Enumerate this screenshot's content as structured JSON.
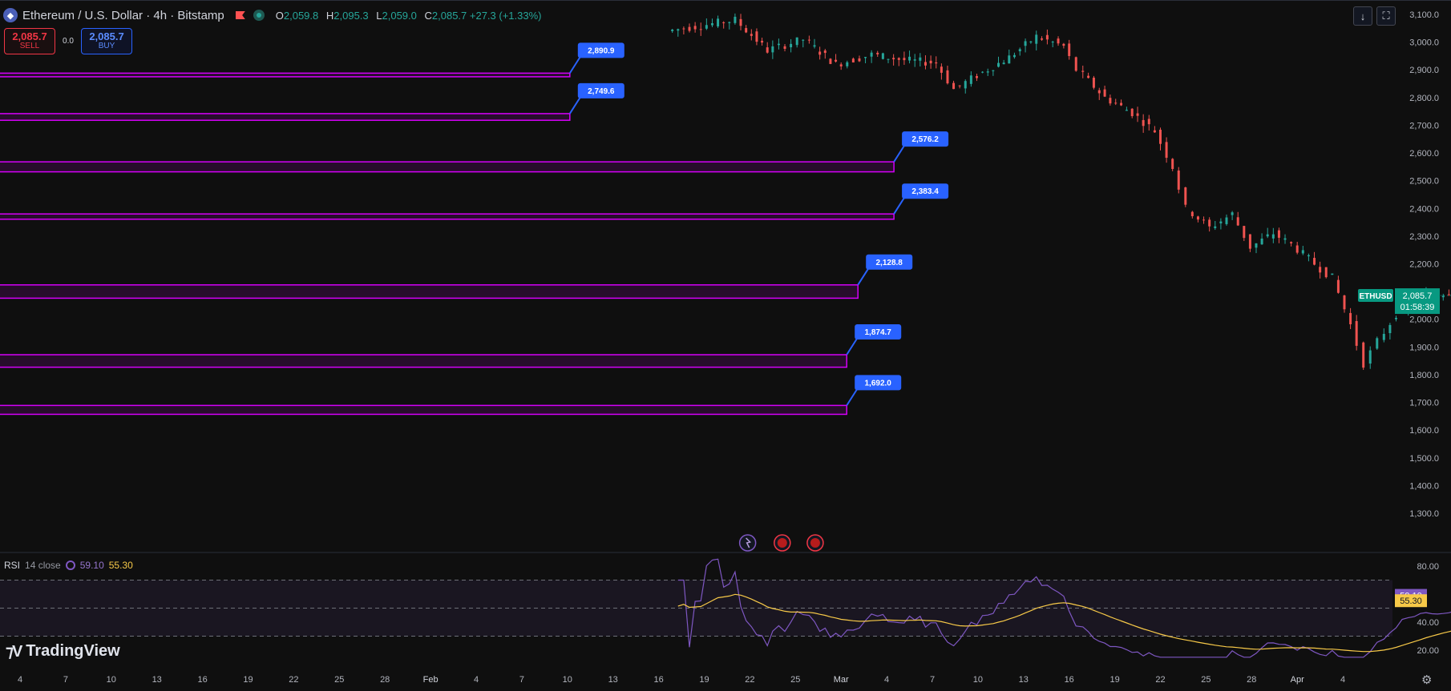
{
  "header": {
    "title": "Ethereum / U.S. Dollar · 4h · Bitstamp",
    "ohlc": [
      {
        "k": "O",
        "v": "2,059.8"
      },
      {
        "k": "H",
        "v": "2,095.3"
      },
      {
        "k": "L",
        "v": "2,059.0"
      },
      {
        "k": "C",
        "v": "2,085.7 +27.3 (+1.33%)"
      }
    ]
  },
  "trade": {
    "sell_price": "2,085.7",
    "sell_label": "SELL",
    "spread": "0.0",
    "buy_price": "2,085.7",
    "buy_label": "BUY"
  },
  "toolbar": {
    "download_icon": "↓",
    "fullscreen_icon": "⛶"
  },
  "rsi_legend": {
    "name": "RSI",
    "params": "14 close",
    "v1": "59.10",
    "v2": "55.30"
  },
  "branding": {
    "logo_text": "TradingView"
  },
  "colors": {
    "bg": "#0f0f0f",
    "up": "#26a69a",
    "down": "#ef5350",
    "zone": "#d500f9",
    "label": "#2962ff",
    "rsi": "#7e57c2",
    "ma": "#f7c948",
    "price_tag": "#089981"
  },
  "chart_data": {
    "type": "candlestick",
    "symbol": "ETHUSD",
    "timeframe": "4h",
    "price_axis": {
      "ticks": [
        "3,100.0",
        "3,000.0",
        "2,900.0",
        "2,800.0",
        "2,700.0",
        "2,600.0",
        "2,500.0",
        "2,400.0",
        "2,300.0",
        "2,200.0",
        "2,100.0",
        "2,000.0",
        "1,900.0",
        "1,800.0",
        "1,700.0",
        "1,600.0",
        "1,500.0",
        "1,400.0",
        "1,300.0"
      ],
      "ylim": [
        1250,
        3120
      ]
    },
    "time_axis": {
      "ticks": [
        "4",
        "7",
        "10",
        "13",
        "16",
        "19",
        "22",
        "25",
        "28",
        "Feb",
        "4",
        "7",
        "10",
        "13",
        "16",
        "19",
        "22",
        "25",
        "Mar",
        "4",
        "7",
        "10",
        "13",
        "16",
        "19",
        "22",
        "25",
        "28",
        "Apr",
        "4"
      ]
    },
    "last_price": {
      "symbol": "ETHUSD",
      "price": "2,085.7",
      "countdown": "01:58:39",
      "value": 2085.7
    },
    "price_path": [
      {
        "t": 14.3,
        "p": 3040
      },
      {
        "t": 15.8,
        "p": 3080
      },
      {
        "t": 16.5,
        "p": 2970
      },
      {
        "t": 17.3,
        "p": 3010
      },
      {
        "t": 18.0,
        "p": 2920
      },
      {
        "t": 18.8,
        "p": 2955
      },
      {
        "t": 19.5,
        "p": 2935
      },
      {
        "t": 20.2,
        "p": 2925
      },
      {
        "t": 20.6,
        "p": 2830
      },
      {
        "t": 21.1,
        "p": 2880
      },
      {
        "t": 21.8,
        "p": 2945
      },
      {
        "t": 22.4,
        "p": 3020
      },
      {
        "t": 23.0,
        "p": 2985
      },
      {
        "t": 23.3,
        "p": 2900
      },
      {
        "t": 23.9,
        "p": 2800
      },
      {
        "t": 24.5,
        "p": 2745
      },
      {
        "t": 25.0,
        "p": 2680
      },
      {
        "t": 25.4,
        "p": 2550
      },
      {
        "t": 25.7,
        "p": 2400
      },
      {
        "t": 26.2,
        "p": 2330
      },
      {
        "t": 26.7,
        "p": 2380
      },
      {
        "t": 27.1,
        "p": 2260
      },
      {
        "t": 27.6,
        "p": 2310
      },
      {
        "t": 28.0,
        "p": 2270
      },
      {
        "t": 28.5,
        "p": 2200
      },
      {
        "t": 28.9,
        "p": 2150
      },
      {
        "t": 29.3,
        "p": 1980
      },
      {
        "t": 29.6,
        "p": 1840
      },
      {
        "t": 29.9,
        "p": 1920
      },
      {
        "t": 30.3,
        "p": 2020
      },
      {
        "t": 30.7,
        "p": 2075
      },
      {
        "t": 31.2,
        "p": 2090
      },
      {
        "t": 31.7,
        "p": 2110
      },
      {
        "t": 32.0,
        "p": 2060
      },
      {
        "t": 32.4,
        "p": 2020
      },
      {
        "t": 32.8,
        "p": 2000
      },
      {
        "t": 33.2,
        "p": 1950
      },
      {
        "t": 33.6,
        "p": 1925
      },
      {
        "t": 34.1,
        "p": 1950
      },
      {
        "t": 34.5,
        "p": 1965
      },
      {
        "t": 34.9,
        "p": 2010
      },
      {
        "t": 35.4,
        "p": 2060
      },
      {
        "t": 35.8,
        "p": 2085
      }
    ],
    "levels": [
      {
        "label": "2,890.9",
        "low": 2875,
        "high": 2888,
        "end": "Feb 10"
      },
      {
        "label": "2,749.6",
        "low": 2718,
        "high": 2742,
        "end": "Feb 10"
      },
      {
        "label": "2,576.2",
        "low": 2532,
        "high": 2568,
        "end": "Mar 3"
      },
      {
        "label": "2,383.4",
        "low": 2361,
        "high": 2380,
        "end": "Mar 3"
      },
      {
        "label": "2,128.8",
        "low": 2076,
        "high": 2124,
        "end": "Mar 2"
      },
      {
        "label": "1,874.7",
        "low": 1827,
        "high": 1872,
        "end": "Mar 1"
      },
      {
        "label": "1,692.0",
        "low": 1657,
        "high": 1689,
        "end": "Mar 1"
      }
    ],
    "events": [
      "earnings-icon",
      "us-flag-icon",
      "us-flag-icon"
    ],
    "rsi": {
      "period": 14,
      "source": "close",
      "value": 59.1,
      "ma_value": 55.3,
      "ticks": [
        "80.00",
        "40.00",
        "20.00"
      ],
      "bands": [
        70,
        50,
        30
      ],
      "ylim": [
        10,
        90
      ]
    }
  }
}
